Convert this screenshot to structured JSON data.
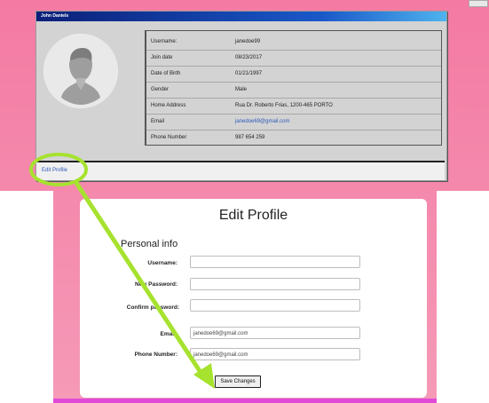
{
  "profile_window": {
    "title": "John Daniels",
    "fields": [
      {
        "label": "Username:",
        "value": "janedoe99"
      },
      {
        "label": "Join date",
        "value": "08/23/2017"
      },
      {
        "label": "Date of Birth",
        "value": "01/21/1997"
      },
      {
        "label": "Gender",
        "value": "Male"
      },
      {
        "label": "Home Address",
        "value": "Rua Dr. Roberto Frias, 1200-465 PORTO"
      },
      {
        "label": "Email",
        "value": "janedoe69@gmail.com"
      },
      {
        "label": "Phone Number",
        "value": "987 654 259"
      }
    ],
    "edit_link": "Edit Profile"
  },
  "edit_form": {
    "title": "Edit Profile",
    "section": "Personal info",
    "labels": {
      "username": "Username:",
      "new_password": "New Password:",
      "confirm_password": "Confirm password:",
      "email": "Email:",
      "phone": "Phone Number:"
    },
    "values": {
      "username": "",
      "new_password": "",
      "confirm_password": "",
      "email": "janedoe69@gmail.com",
      "phone": "janedoe69@gmail.com"
    },
    "save_label": "Save Changes"
  },
  "annotation": {
    "color": "#a6e22e",
    "icons": [
      "highlight-ellipse-icon",
      "arrow-icon"
    ]
  }
}
